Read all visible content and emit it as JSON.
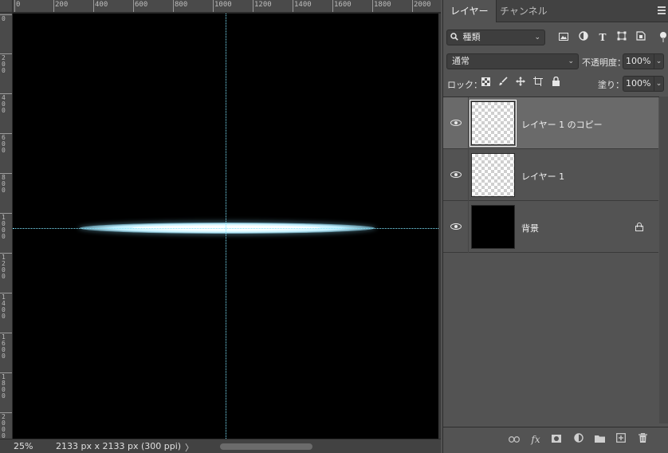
{
  "ruler": {
    "top_labels": [
      "0",
      "200",
      "400",
      "600",
      "800",
      "1000",
      "1200",
      "1400",
      "1600",
      "1800",
      "2000"
    ],
    "left_labels": [
      "0",
      "200",
      "400",
      "600",
      "800",
      "1000",
      "1200",
      "1400",
      "1600",
      "1800",
      "2000"
    ]
  },
  "status": {
    "zoom": "25%",
    "doc_info": "2133 px x 2133 px (300 ppi)",
    "arrow": "〉"
  },
  "panel": {
    "tabs": [
      "レイヤー",
      "チャンネル"
    ],
    "active_tab": "レイヤー",
    "filter": {
      "icon": "search-icon",
      "label": "種類"
    },
    "filter_icons": [
      "image-filter-icon",
      "adjustment-filter-icon",
      "type-filter-icon",
      "shape-filter-icon",
      "smart-object-filter-icon"
    ],
    "blend_mode": "通常",
    "opacity_label": "不透明度：",
    "opacity_value": "100%",
    "lock_label": "ロック：",
    "lock_icons": [
      "lock-transparent-pixels-icon",
      "lock-image-pixels-icon",
      "lock-position-icon",
      "lock-artboard-icon",
      "lock-all-icon"
    ],
    "fill_label": "塗り：",
    "fill_value": "100%"
  },
  "layers": [
    {
      "name": "レイヤー 1 のコピー",
      "visible": true,
      "selected": true,
      "thumbnail": "transparent",
      "locked": false
    },
    {
      "name": "レイヤー 1",
      "visible": true,
      "selected": false,
      "thumbnail": "transparent",
      "locked": false
    },
    {
      "name": "背景",
      "visible": true,
      "selected": false,
      "thumbnail": "black",
      "locked": true
    }
  ],
  "footer_icons": [
    "link-layers-icon",
    "layer-style-fx-icon",
    "add-mask-icon",
    "adjustment-layer-icon",
    "new-group-folder-icon",
    "new-layer-icon",
    "delete-trash-icon"
  ],
  "colors": {
    "canvas_bg": "#000000",
    "guide": "#7fe6ff",
    "flare": "#ffffff",
    "panel_bg": "#535353",
    "selected_layer": "#6a6a6a"
  }
}
